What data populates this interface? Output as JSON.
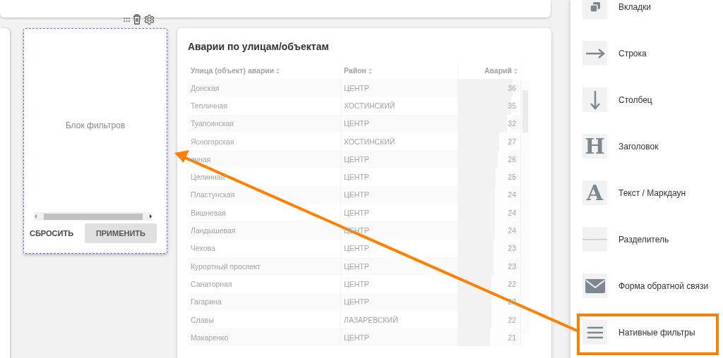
{
  "filter_block": {
    "label": "Блок фильтров",
    "buttons": [
      {
        "label": "СБРОСИТЬ",
        "kind": "text"
      },
      {
        "label": "ПРИМЕНИТЬ",
        "kind": "filled"
      }
    ]
  },
  "table_card": {
    "title": "Аварии по улицам/объектам",
    "columns": [
      "Улица (объект) аварии",
      "Район",
      "Аварий"
    ],
    "rows": [
      {
        "street": "Донская",
        "district": "ЦЕНТР",
        "count": "36",
        "level": 1
      },
      {
        "street": "Тепличная",
        "district": "ХОСТИНСКИЙ",
        "count": "35",
        "level": 0.97
      },
      {
        "street": "Туапсинская",
        "district": "ЦЕНТР",
        "count": "32",
        "level": 0.89
      },
      {
        "street": "Ясногорская",
        "district": "ХОСТИНСКИЙ",
        "count": "27",
        "level": 0.75
      },
      {
        "street": "ечная",
        "district": "ЦЕНТР",
        "count": "26",
        "level": 0.72
      },
      {
        "street": "Целинная",
        "district": "ЦЕНТР",
        "count": "25",
        "level": 0.69
      },
      {
        "street": "Пластунская",
        "district": "ЦЕНТР",
        "count": "24",
        "level": 0.67
      },
      {
        "street": "Вишневая",
        "district": "ЦЕНТР",
        "count": "24",
        "level": 0.67
      },
      {
        "street": "Ландышевая",
        "district": "ЦЕНТР",
        "count": "24",
        "level": 0.67
      },
      {
        "street": "Чехова",
        "district": "ЦЕНТР",
        "count": "23",
        "level": 0.64
      },
      {
        "street": "Курортный проспект",
        "district": "ЦЕНТР",
        "count": "23",
        "level": 0.64
      },
      {
        "street": "Санаторная",
        "district": "ЦЕНТР",
        "count": "22",
        "level": 0.61
      },
      {
        "street": "Гагарина",
        "district": "ЦЕНТР",
        "count": "22",
        "level": 0.61
      },
      {
        "street": "Славы",
        "district": "ЛАЗАРЕВСКИЙ",
        "count": "22",
        "level": 0.61
      },
      {
        "street": "Макаренко",
        "district": "ЦЕНТР",
        "count": "21",
        "level": 0.58
      }
    ]
  },
  "sidebar": {
    "items": [
      {
        "label": "Вкладки",
        "kind": "tabs"
      },
      {
        "label": "Строка",
        "kind": "row"
      },
      {
        "label": "Столбец",
        "kind": "column"
      },
      {
        "label": "Заголовок",
        "kind": "heading",
        "glyph": "H"
      },
      {
        "label": "Текст / Маркдаун",
        "kind": "text",
        "glyph": "A"
      },
      {
        "label": "Разделитель",
        "kind": "divider"
      },
      {
        "label": "Форма обратной связи",
        "kind": "feedback"
      },
      {
        "label": "Нативные фильтры",
        "kind": "filters"
      }
    ]
  }
}
